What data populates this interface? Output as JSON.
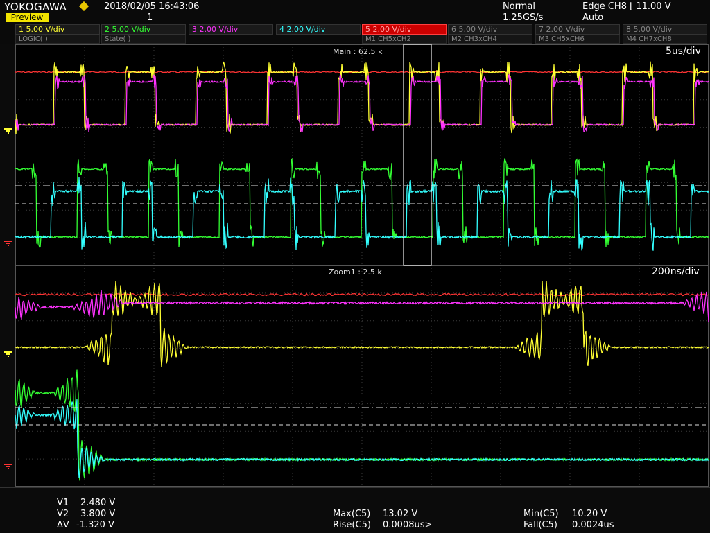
{
  "header": {
    "brand": "YOKOGAWA",
    "preview_label": "Preview",
    "datetime": "2018/02/05  16:43:06",
    "acquisition_count": "1",
    "acq_mode": "Normal",
    "sample_rate": "1.25GS/s",
    "trigger_line1": "Edge CH8 ⌊ 11.00 V",
    "trigger_line2": "Auto"
  },
  "channels": [
    {
      "label": "1  5.00 V/div",
      "color": "#ffff33"
    },
    {
      "label": "2  5.00 V/div",
      "color": "#33ff33"
    },
    {
      "label": "3  2.00 V/div",
      "color": "#ff33ff"
    },
    {
      "label": "4  2.00 V/div",
      "color": "#33ffff"
    },
    {
      "label": "5  2.00 V/div",
      "color": "#ff3333"
    },
    {
      "label": "6  5.00 V/div",
      "color": "#888888"
    },
    {
      "label": "7  2.00 V/div",
      "color": "#888888"
    },
    {
      "label": "8  5.00 V/div",
      "color": "#888888"
    }
  ],
  "sub_channels": [
    "LOGIC(  )",
    "State(  )",
    "M1 CH5xCH2",
    "M2 CH3xCH4",
    "M3 CH5xCH6",
    "M4 CH7xCH8"
  ],
  "main_window": {
    "label": "Main : 62.5 k",
    "timebase": "5us/div"
  },
  "zoom_window": {
    "label": "Zoom1 : 2.5 k",
    "timebase": "200ns/div"
  },
  "measurements": {
    "v1": {
      "label": "V1",
      "value": "2.480 V"
    },
    "v2": {
      "label": "V2",
      "value": "3.800 V"
    },
    "dv": {
      "label": "ΔV",
      "value": "-1.320 V"
    },
    "max": {
      "label": "Max(C5)",
      "value": "13.02 V"
    },
    "rise": {
      "label": "Rise(C5)",
      "value": "0.0008us>"
    },
    "min": {
      "label": "Min(C5)",
      "value": "10.20 V"
    },
    "fall": {
      "label": "Fall(C5)",
      "value": "0.0024us"
    }
  },
  "colors": {
    "ch1": "#ffff33",
    "ch2": "#33ff33",
    "ch3": "#ff33ff",
    "ch4": "#33ffff",
    "ch5": "#ff3333",
    "grid": "#3a3a3a",
    "preview_bg": "#f2e400"
  },
  "icons": [
    "brand-diamond-icon",
    "ground-marker-icon"
  ]
}
